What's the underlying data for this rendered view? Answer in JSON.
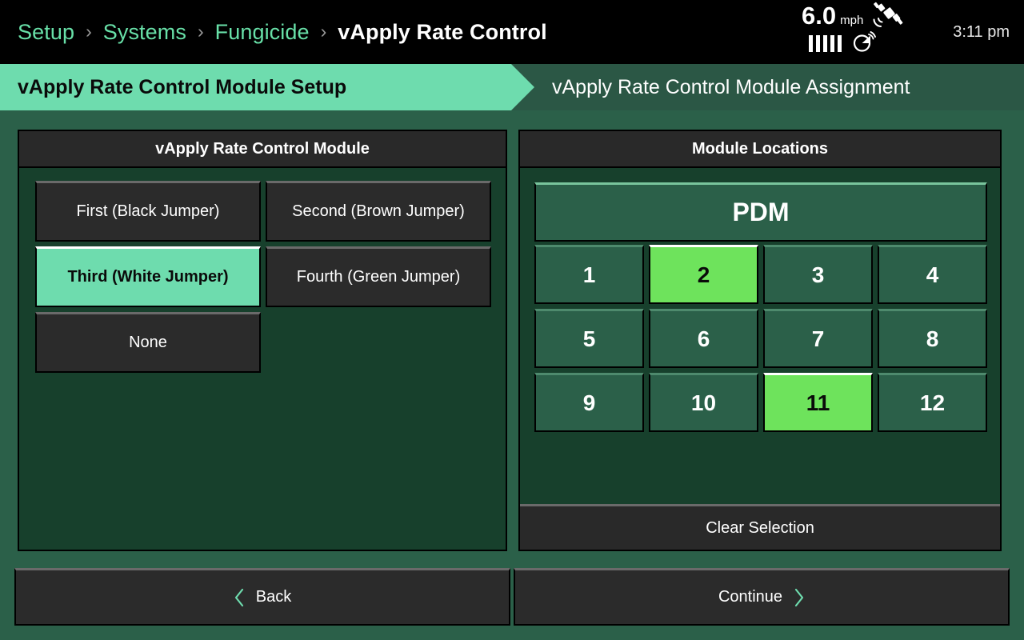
{
  "statusbar": {
    "breadcrumb": [
      {
        "label": "Setup",
        "current": false
      },
      {
        "label": "Systems",
        "current": false
      },
      {
        "label": "Fungicide",
        "current": false
      },
      {
        "label": "vApply Rate Control",
        "current": true
      }
    ],
    "separator": "›",
    "speed_value": "6.0",
    "speed_unit": "mph",
    "satellite_icon": "gps-satellite-icon",
    "signal_bars": 5,
    "dish_icon": "satellite-dish-icon",
    "time": "3:11 pm"
  },
  "tabs": [
    {
      "label": "vApply Rate Control Module Setup",
      "active": true
    },
    {
      "label": "vApply Rate Control Module Assignment",
      "active": false
    }
  ],
  "left_panel": {
    "title": "vApply Rate Control Module",
    "options": [
      {
        "label": "First (Black Jumper)",
        "selected": false
      },
      {
        "label": "Second (Brown Jumper)",
        "selected": false
      },
      {
        "label": "Third (White Jumper)",
        "selected": true
      },
      {
        "label": "Fourth (Green Jumper)",
        "selected": false
      },
      {
        "label": "None",
        "selected": false
      }
    ]
  },
  "right_panel": {
    "title": "Module Locations",
    "pdm_label": "PDM",
    "modules": [
      {
        "label": "1",
        "selected": false
      },
      {
        "label": "2",
        "selected": true
      },
      {
        "label": "3",
        "selected": false
      },
      {
        "label": "4",
        "selected": false
      },
      {
        "label": "5",
        "selected": false
      },
      {
        "label": "6",
        "selected": false
      },
      {
        "label": "7",
        "selected": false
      },
      {
        "label": "8",
        "selected": false
      },
      {
        "label": "9",
        "selected": false
      },
      {
        "label": "10",
        "selected": false
      },
      {
        "label": "11",
        "selected": true
      },
      {
        "label": "12",
        "selected": false
      }
    ],
    "clear_label": "Clear Selection"
  },
  "nav": {
    "back_label": "Back",
    "continue_label": "Continue",
    "back_icon": "chevron-left-icon",
    "continue_icon": "chevron-right-icon"
  },
  "colors": {
    "page_background": "#2b6049",
    "panel_background": "#17402c",
    "panel_header": "#292929",
    "accent_teal": "#6edcae",
    "accent_green": "#6ee35c",
    "button_dark": "#2b2b2b",
    "statusbar": "#000000",
    "tab_inactive": "#2b5745"
  }
}
